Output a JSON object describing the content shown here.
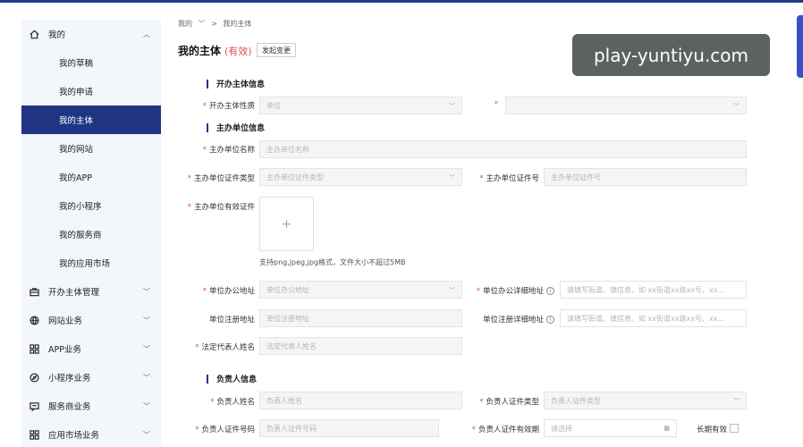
{
  "sidebar": {
    "my": {
      "label": "我的"
    },
    "sub": [
      {
        "label": "我的草稿"
      },
      {
        "label": "我的申请"
      },
      {
        "label": "我的主体"
      },
      {
        "label": "我的网站"
      },
      {
        "label": "我的APP"
      },
      {
        "label": "我的小程序"
      },
      {
        "label": "我的服务商"
      },
      {
        "label": "我的应用市场"
      }
    ],
    "groups": [
      {
        "label": "开办主体管理",
        "icon": "briefcase-icon"
      },
      {
        "label": "网站业务",
        "icon": "globe-icon"
      },
      {
        "label": "APP业务",
        "icon": "grid-icon"
      },
      {
        "label": "小程序业务",
        "icon": "compass-icon"
      },
      {
        "label": "服务商业务",
        "icon": "message-icon"
      },
      {
        "label": "应用市场业务",
        "icon": "grid-icon"
      }
    ]
  },
  "breadcrumb": {
    "first": "我的",
    "sep": ">",
    "current": "我的主体"
  },
  "page": {
    "title": "我的主体",
    "status": "(有效)",
    "change_button": "发起变更"
  },
  "sections": {
    "s1": "开办主体信息",
    "s2": "主办单位信息",
    "s3": "负责人信息"
  },
  "form": {
    "nature_label": "开办主体性质",
    "nature_value": "单位",
    "org_name_label": "主办单位名称",
    "org_name_ph": "主办单位名称",
    "cert_type_label": "主办单位证件类型",
    "cert_type_ph": "主办单位证件类型",
    "cert_no_label": "主办单位证件号",
    "cert_no_ph": "主办单位证件号",
    "valid_cert_label": "主办单位有效证件",
    "upload_plus": "+",
    "upload_hint": "支持png,jpeg,jpg格式，文件大小不超过5MB",
    "office_addr_label": "单位办公地址",
    "office_addr_ph": "单位办公地址",
    "office_detail_label": "单位办公详细地址",
    "office_detail_ph": "请填写街道、镇信息，如 xx街道xx路xx号、xx...",
    "reg_addr_label": "单位注册地址",
    "reg_addr_ph": "单位注册地址",
    "reg_detail_label": "单位注册详细地址",
    "reg_detail_ph": "请填写街道、镇信息，如 xx街道xx路xx号、xx...",
    "legal_label": "法定代表人姓名",
    "legal_ph": "法定代表人姓名",
    "person_name_label": "负责人姓名",
    "person_name_ph": "负责人姓名",
    "person_cert_type_label": "负责人证件类型",
    "person_cert_type_ph": "负责人证件类型",
    "person_cert_no_label": "负责人证件号码",
    "person_cert_no_ph": "负责人证件号码",
    "person_valid_label": "负责人证件有效期",
    "person_valid_ph": "请选择",
    "long_term_label": "长期有效"
  },
  "watermark": "play-yuntiyu.com"
}
